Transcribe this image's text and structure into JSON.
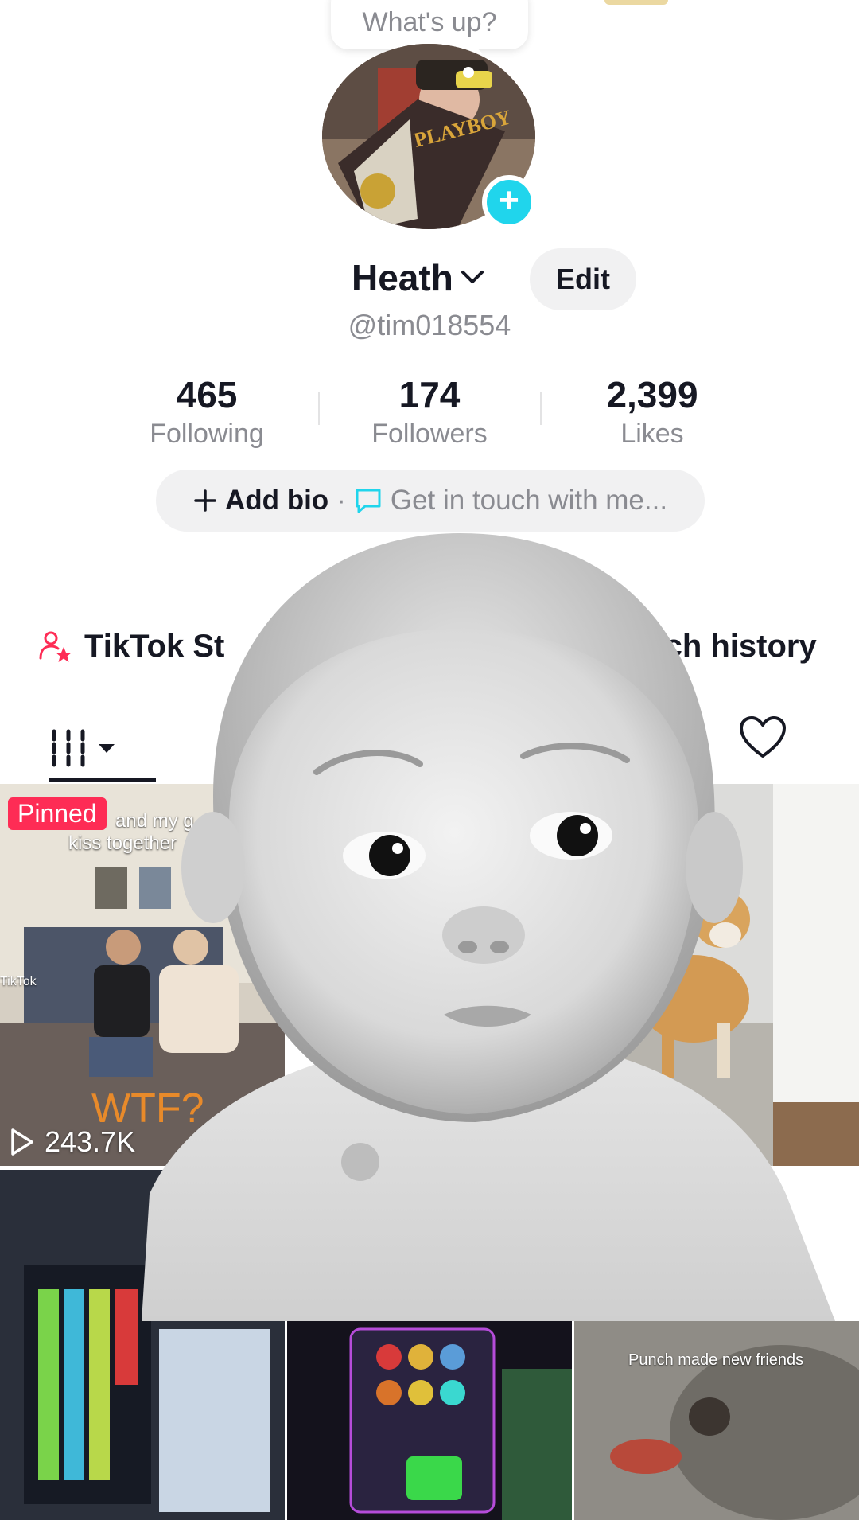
{
  "bubble": {
    "text": "What's up?"
  },
  "profile": {
    "name": "Heath",
    "edit_label": "Edit",
    "handle": "@tim018554"
  },
  "stats": [
    {
      "value": "465",
      "label": "Following"
    },
    {
      "value": "174",
      "label": "Followers"
    },
    {
      "value": "2,399",
      "label": "Likes"
    }
  ],
  "bio": {
    "add_label": "Add bio",
    "separator": "·",
    "contact_label": "Get in touch with me..."
  },
  "links": {
    "studio_label": "TikTok St",
    "watch_label": "atch history"
  },
  "videos": {
    "pinned_label": "Pinned",
    "pinned_caption_1": "and my g",
    "pinned_caption_2": "kiss together",
    "pinned_overlay": "WTF?",
    "pinned_views": "243.7K",
    "punch_caption": "Punch made new friends",
    "tiktok_watermark": "TikTok"
  },
  "colors": {
    "accent": "#fe2c55",
    "avatar_add": "#20d5ec",
    "bio_icon": "#20d5ec",
    "text_primary": "#161823",
    "text_secondary": "#8a8b91"
  },
  "icons": [
    "plus-icon",
    "chevron-down-icon",
    "chat-bubble-icon",
    "add-user-star-icon",
    "grid-icon",
    "caret-down-icon",
    "heart-icon",
    "play-icon"
  ]
}
